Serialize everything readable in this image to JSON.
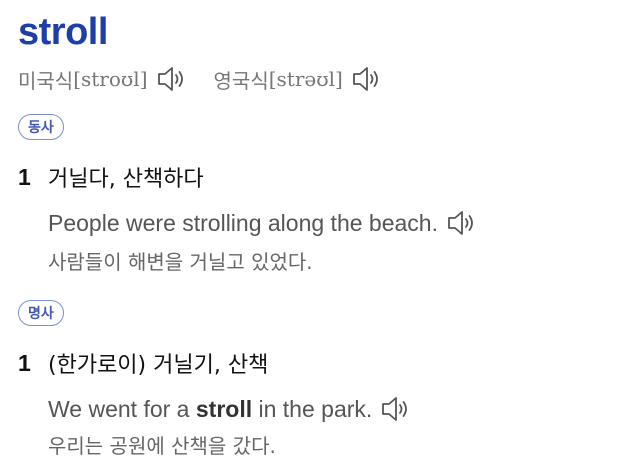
{
  "headword": "stroll",
  "pronunciations": [
    {
      "label": "미국식",
      "ipa": "[stroʊl]",
      "icon": "speaker-icon"
    },
    {
      "label": "영국식",
      "ipa": "[strəʊl]",
      "icon": "speaker-icon"
    }
  ],
  "entries": [
    {
      "pos": "동사",
      "number": "1",
      "definition": "거닐다, 산책하다",
      "example": {
        "before": "People were strolling along the beach.",
        "highlight": "",
        "after": ""
      },
      "translation": "사람들이 해변을 거닐고 있었다."
    },
    {
      "pos": "명사",
      "number": "1",
      "definition": "(한가로이) 거닐기, 산책",
      "example": {
        "before": "We went for a ",
        "highlight": "stroll",
        "after": " in the park."
      },
      "translation": "우리는 공원에 산책을 갔다."
    }
  ],
  "colors": {
    "headword": "#1f3fa8",
    "badge_border": "#7d8fd0",
    "badge_text": "#4257b2",
    "muted": "#777777"
  }
}
